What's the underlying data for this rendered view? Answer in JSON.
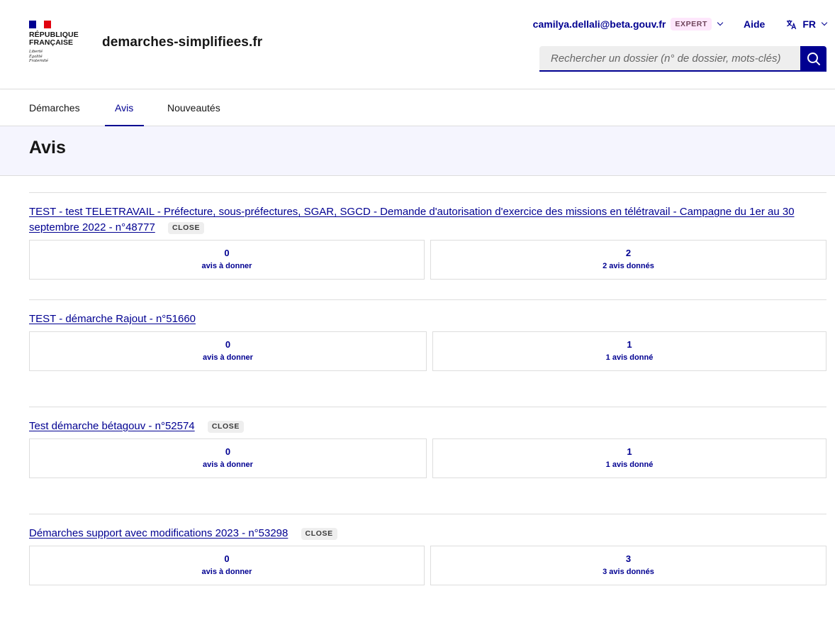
{
  "header": {
    "logo": {
      "name": "RÉPUBLIQUE\nFRANÇAISE",
      "motto": "Liberté\nÉgalité\nFraternité"
    },
    "service_name": "demarches-simplifiees.fr",
    "user_email": "camilya.dellali@beta.gouv.fr",
    "role_badge": "EXPERT",
    "aide_label": "Aide",
    "lang_label": "FR",
    "search_placeholder": "Rechercher un dossier (n° de dossier, mots-clés)"
  },
  "nav": {
    "items": [
      {
        "label": "Démarches",
        "active": false
      },
      {
        "label": "Avis",
        "active": true
      },
      {
        "label": "Nouveautés",
        "active": false
      }
    ]
  },
  "page_title": "Avis",
  "close_label": "CLOSE",
  "procedures": [
    {
      "title": "TEST - test TELETRAVAIL - Préfecture, sous-préfectures, SGAR, SGCD - Demande d'autorisation d'exercice des missions en télétravail - Campagne du 1er au 30 septembre 2022 - n°48777",
      "closed": true,
      "pending_count": "0",
      "pending_label": "avis à donner",
      "given_count": "2",
      "given_label": "2 avis donnés"
    },
    {
      "title": "TEST - démarche Rajout - n°51660",
      "closed": false,
      "pending_count": "0",
      "pending_label": "avis à donner",
      "given_count": "1",
      "given_label": "1 avis donné"
    },
    {
      "title": "Test démarche bétagouv - n°52574",
      "closed": true,
      "pending_count": "0",
      "pending_label": "avis à donner",
      "given_count": "1",
      "given_label": "1 avis donné"
    },
    {
      "title": "Démarches support avec modifications 2023 - n°53298",
      "closed": true,
      "pending_count": "0",
      "pending_label": "avis à donner",
      "given_count": "3",
      "given_label": "3 avis donnés"
    }
  ],
  "colors": {
    "primary": "#000091",
    "title_band": "#f5f5fe",
    "expert_badge_bg": "#fee7fc",
    "close_badge_bg": "#eeeeee",
    "marianne_red": "#e1000f"
  }
}
